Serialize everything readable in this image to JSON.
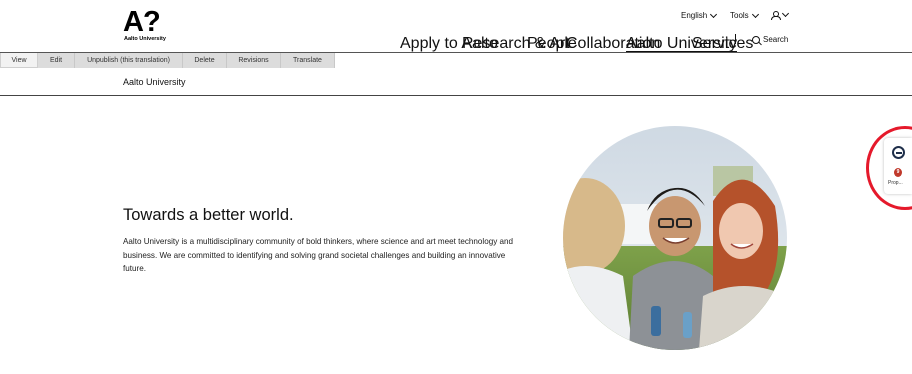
{
  "logo": {
    "mark": "A?",
    "text": "Aalto University"
  },
  "utility": {
    "language": "English",
    "tools": "Tools"
  },
  "nav": {
    "items": [
      {
        "label": "Apply to Aalto"
      },
      {
        "label": "Research & Art"
      },
      {
        "label": "People"
      },
      {
        "label": "Collaboration"
      },
      {
        "label": "Aalto University",
        "active": true
      },
      {
        "label": "Services"
      }
    ],
    "search_label": "Search"
  },
  "admin_tabs": [
    "View",
    "Edit",
    "Unpublish (this translation)",
    "Delete",
    "Revisions",
    "Translate"
  ],
  "page_title": "Aalto University",
  "hero": {
    "heading": "Towards a better world.",
    "body": "Aalto University is a multidisciplinary community of bold thinkers, where science and art meet technology and business. We are committed to identifying and solving grand societal challenges and building an innovative future."
  },
  "widget": {
    "badge": "9",
    "label": "Prop..."
  },
  "colors": {
    "accent": "#111111",
    "highlight_ring": "#e5192b",
    "tab_bg": "#dcdcdc"
  }
}
